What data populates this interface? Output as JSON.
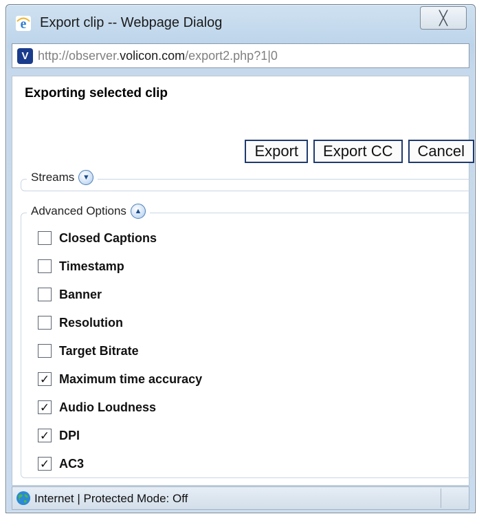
{
  "window": {
    "title": "Export clip -- Webpage Dialog",
    "close_glyph": "╳"
  },
  "address": {
    "url_prefix": "http://observer.",
    "url_domain": "volicon.com",
    "url_suffix": "/export2.php?1|0",
    "site_icon_letter": "V"
  },
  "dialog": {
    "heading": "Exporting selected clip",
    "buttons": {
      "export": "Export",
      "export_cc": "Export CC",
      "cancel": "Cancel"
    },
    "streams": {
      "label": "Streams",
      "toggle_glyph": "▼"
    },
    "advanced": {
      "label": "Advanced Options",
      "toggle_glyph": "▲",
      "options": [
        {
          "label": "Closed Captions",
          "checked": false
        },
        {
          "label": "Timestamp",
          "checked": false
        },
        {
          "label": "Banner",
          "checked": false
        },
        {
          "label": "Resolution",
          "checked": false
        },
        {
          "label": "Target Bitrate",
          "checked": false
        },
        {
          "label": "Maximum time accuracy",
          "checked": true
        },
        {
          "label": "Audio Loudness",
          "checked": true
        },
        {
          "label": "DPI",
          "checked": true
        },
        {
          "label": "AC3",
          "checked": true
        }
      ]
    }
  },
  "status": {
    "text": "Internet | Protected Mode: Off"
  },
  "colors": {
    "frame": "#c9dbee",
    "button_border": "#1e3a6e",
    "toggle_blue": "#4d7fb8"
  }
}
